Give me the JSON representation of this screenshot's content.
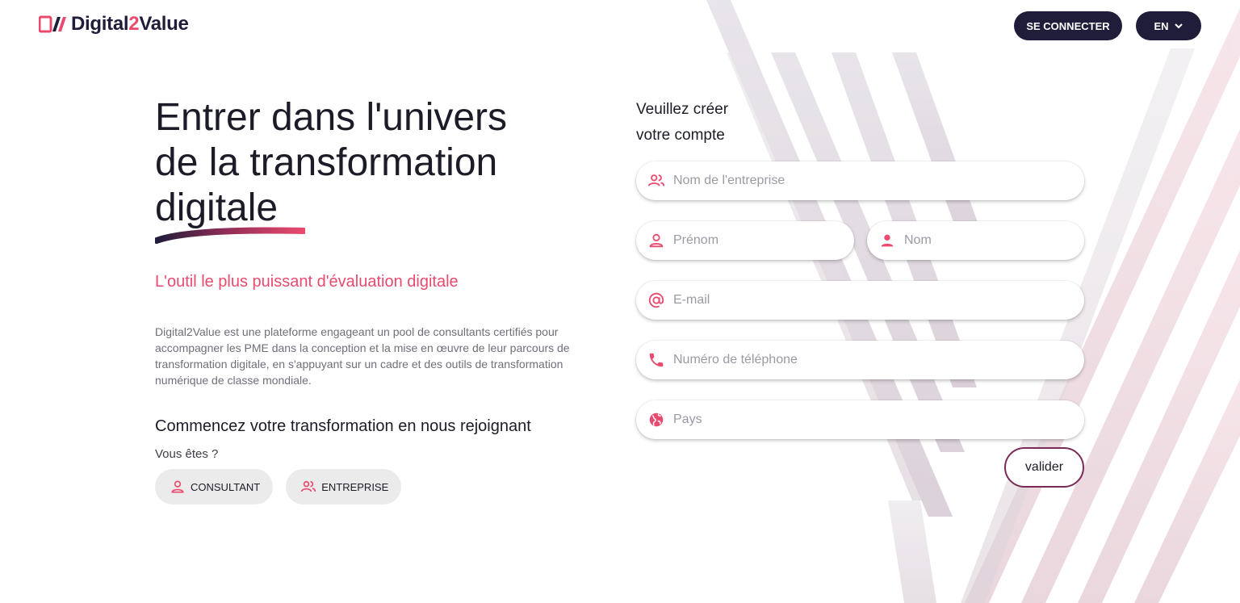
{
  "brand": {
    "name_part1": "Digital",
    "name_part2": "2",
    "name_part3": "Value",
    "logo_mark": "D2",
    "accent": "#ea4a6e",
    "dark": "#1f1d3a"
  },
  "header": {
    "login_label": "SE CONNECTER",
    "lang_label": "EN",
    "lang_icon": "chevron-down-icon"
  },
  "hero": {
    "line1": "Entrer dans l'univers",
    "line2": "de la transformation",
    "line3": "digitale",
    "tagline": "L'outil le plus puissant d'évaluation digitale",
    "description": "Digital2Value est une plateforme engageant un pool de consultants certifiés pour accompagner les PME dans la conception et la mise en œuvre de leur parcours de transformation digitale, en s'appuyant sur un cadre et des outils de transformation numérique de classe mondiale.",
    "join_title": "Commencez votre transformation en nous rejoignant",
    "you_are": "Vous êtes ?",
    "roles": [
      {
        "label": "CONSULTANT",
        "icon": "user-icon"
      },
      {
        "label": "ENTREPRISE",
        "icon": "users-icon"
      }
    ]
  },
  "form": {
    "title_line1": "Veuillez créer",
    "title_line2": "votre compte",
    "company": {
      "placeholder": "Nom de l'entreprise",
      "icon": "users-icon"
    },
    "first_name": {
      "placeholder": "Prénom",
      "icon": "user-outline-icon"
    },
    "last_name": {
      "placeholder": "Nom",
      "icon": "user-filled-icon"
    },
    "email": {
      "placeholder": "E-mail",
      "icon": "at-icon"
    },
    "phone": {
      "placeholder": "Numéro de téléphone",
      "icon": "phone-icon"
    },
    "country": {
      "placeholder": "Pays",
      "icon": "globe-icon"
    },
    "submit_label": "valider"
  }
}
